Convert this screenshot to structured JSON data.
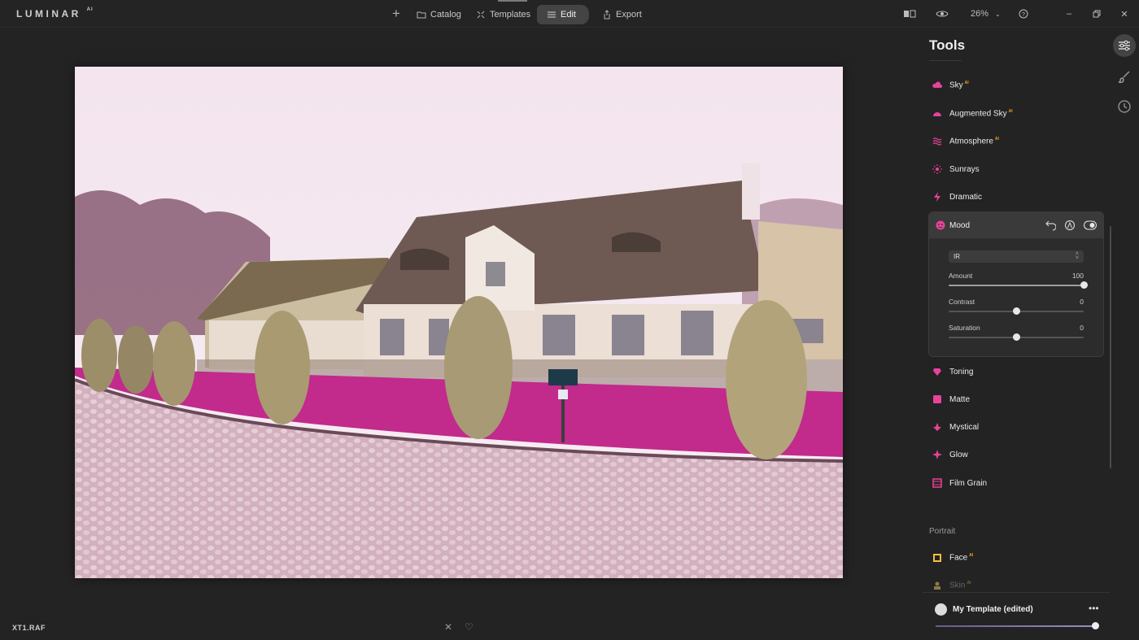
{
  "app": {
    "logo": "LUMINAR",
    "logo_sup": "AI"
  },
  "nav": {
    "add": "+",
    "catalog": "Catalog",
    "templates": "Templates",
    "edit": "Edit",
    "export": "Export"
  },
  "toolbar": {
    "zoom": "26%"
  },
  "file": {
    "name": "XT1.RAF"
  },
  "panel": {
    "title": "Tools",
    "tools_before": [
      {
        "label": "Sky",
        "ai": "AI",
        "icon": "cloud-icon"
      },
      {
        "label": "Augmented Sky",
        "ai": "AI",
        "icon": "augmented-sky-icon"
      },
      {
        "label": "Atmosphere",
        "ai": "AI",
        "icon": "atmosphere-icon"
      },
      {
        "label": "Sunrays",
        "ai": "",
        "icon": "sunrays-icon"
      },
      {
        "label": "Dramatic",
        "ai": "",
        "icon": "dramatic-icon"
      }
    ],
    "mood": {
      "title": "Mood",
      "lut": "IR",
      "sliders": [
        {
          "label": "Amount",
          "value": "100",
          "fraction": 1.0
        },
        {
          "label": "Contrast",
          "value": "0",
          "fraction": 0.5
        },
        {
          "label": "Saturation",
          "value": "0",
          "fraction": 0.5
        }
      ]
    },
    "tools_after": [
      {
        "label": "Toning",
        "ai": "",
        "icon": "toning-icon"
      },
      {
        "label": "Matte",
        "ai": "",
        "icon": "matte-icon"
      },
      {
        "label": "Mystical",
        "ai": "",
        "icon": "mystical-icon"
      },
      {
        "label": "Glow",
        "ai": "",
        "icon": "glow-icon"
      },
      {
        "label": "Film Grain",
        "ai": "",
        "icon": "film-grain-icon"
      }
    ],
    "portrait_section": "Portrait",
    "portrait_tools": [
      {
        "label": "Face",
        "ai": "AI",
        "icon": "face-icon"
      },
      {
        "label": "Skin",
        "ai": "AI",
        "icon": "skin-icon"
      }
    ]
  },
  "template": {
    "name": "My Template (edited)",
    "more": "•••",
    "amount_fraction": 1.0
  },
  "colors": {
    "accent": "#e8429a",
    "ai_badge": "#f0a020"
  }
}
